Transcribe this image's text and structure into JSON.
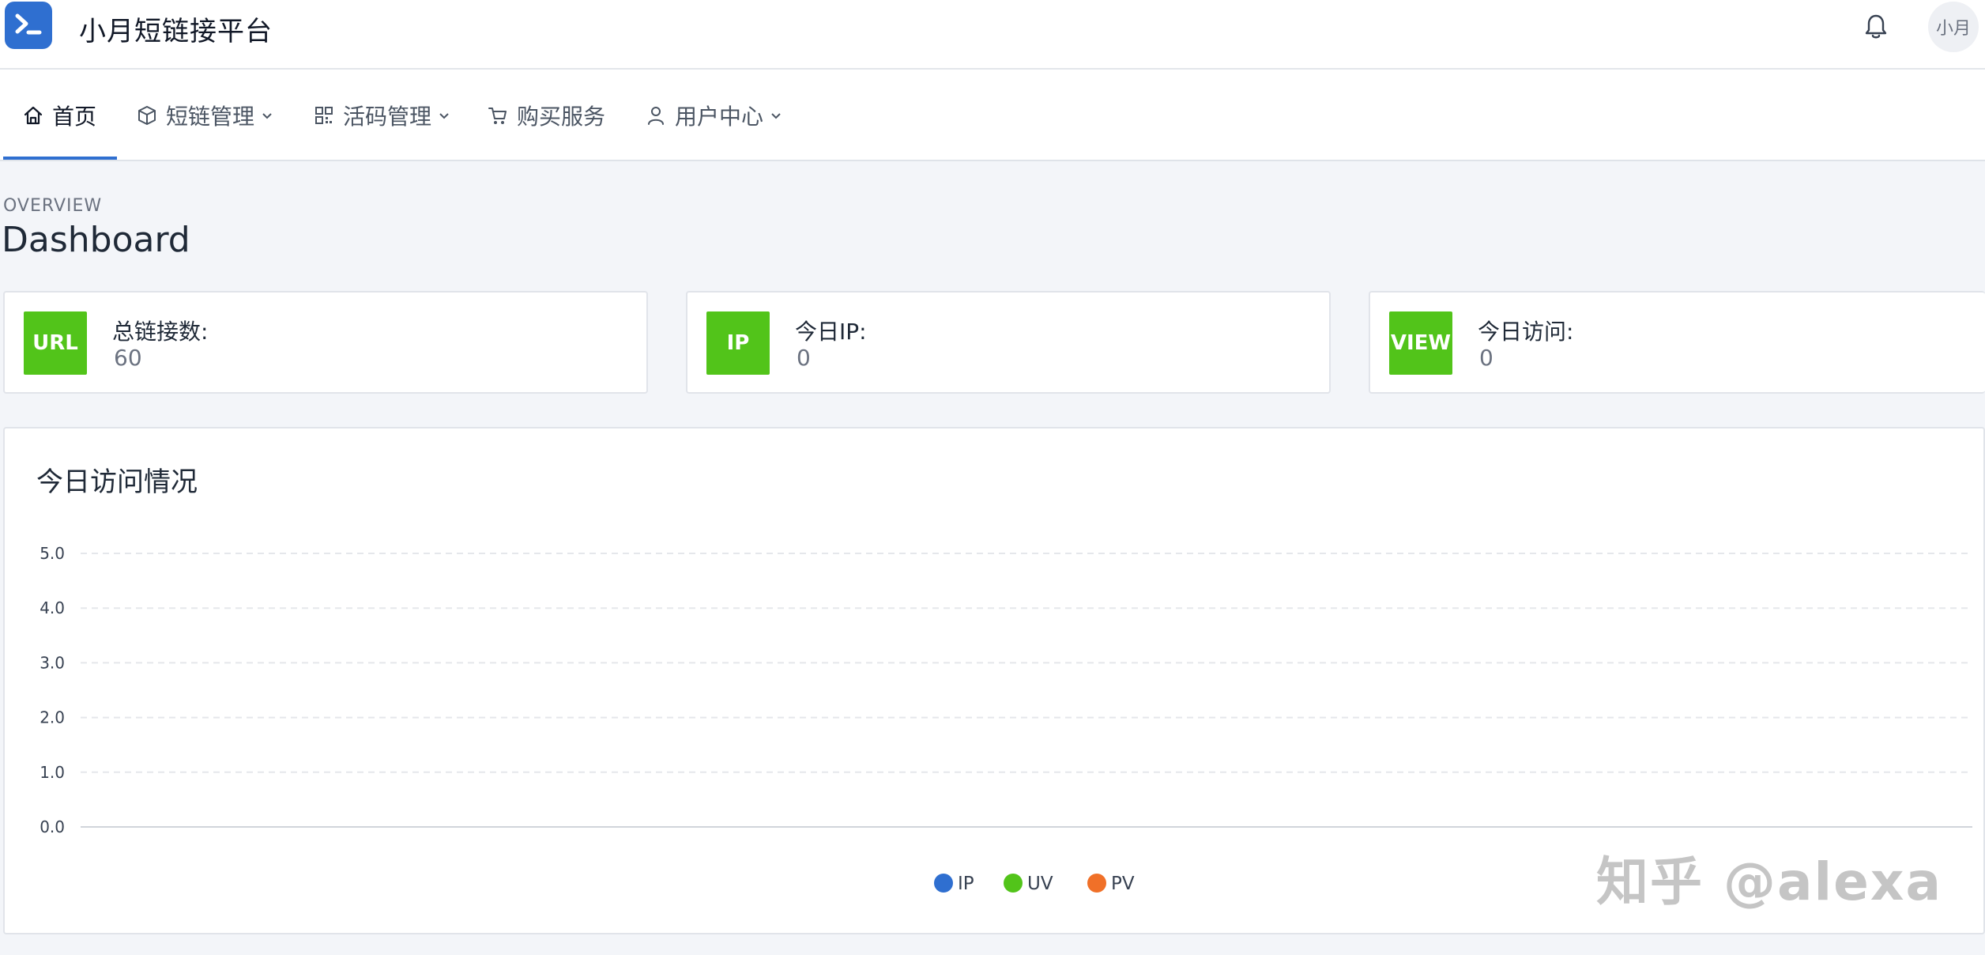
{
  "header": {
    "brand": "小月短链接平台",
    "avatar_text": "小月"
  },
  "nav": {
    "items": [
      {
        "label": "首页",
        "icon": "home-icon",
        "has_dropdown": false,
        "active": true
      },
      {
        "label": "短链管理",
        "icon": "cube-icon",
        "has_dropdown": true,
        "active": false
      },
      {
        "label": "活码管理",
        "icon": "qrcode-icon",
        "has_dropdown": true,
        "active": false
      },
      {
        "label": "购买服务",
        "icon": "cart-icon",
        "has_dropdown": false,
        "active": false
      },
      {
        "label": "用户中心",
        "icon": "user-icon",
        "has_dropdown": true,
        "active": false
      }
    ]
  },
  "page": {
    "overview": "OVERVIEW",
    "title": "Dashboard"
  },
  "stats": [
    {
      "badge": "URL",
      "label": "总链接数:",
      "value": "60"
    },
    {
      "badge": "IP",
      "label": "今日IP:",
      "value": "0"
    },
    {
      "badge": "VIEW",
      "label": "今日访问:",
      "value": "0"
    }
  ],
  "colors": {
    "accent": "#2f6fd0",
    "badge_green": "#52c41a",
    "series_ip": "#2f6fd0",
    "series_uv": "#52c41a",
    "series_pv": "#f07028"
  },
  "chart_data": {
    "type": "line",
    "title": "今日访问情况",
    "y_ticks": [
      "5.0",
      "4.0",
      "3.0",
      "2.0",
      "1.0",
      "0.0"
    ],
    "ylim": [
      0,
      5
    ],
    "grid": true,
    "legend_position": "bottom-center",
    "series": [
      {
        "name": "IP",
        "values": []
      },
      {
        "name": "UV",
        "values": []
      },
      {
        "name": "PV",
        "values": []
      }
    ]
  },
  "watermark": "知乎 @alexa"
}
